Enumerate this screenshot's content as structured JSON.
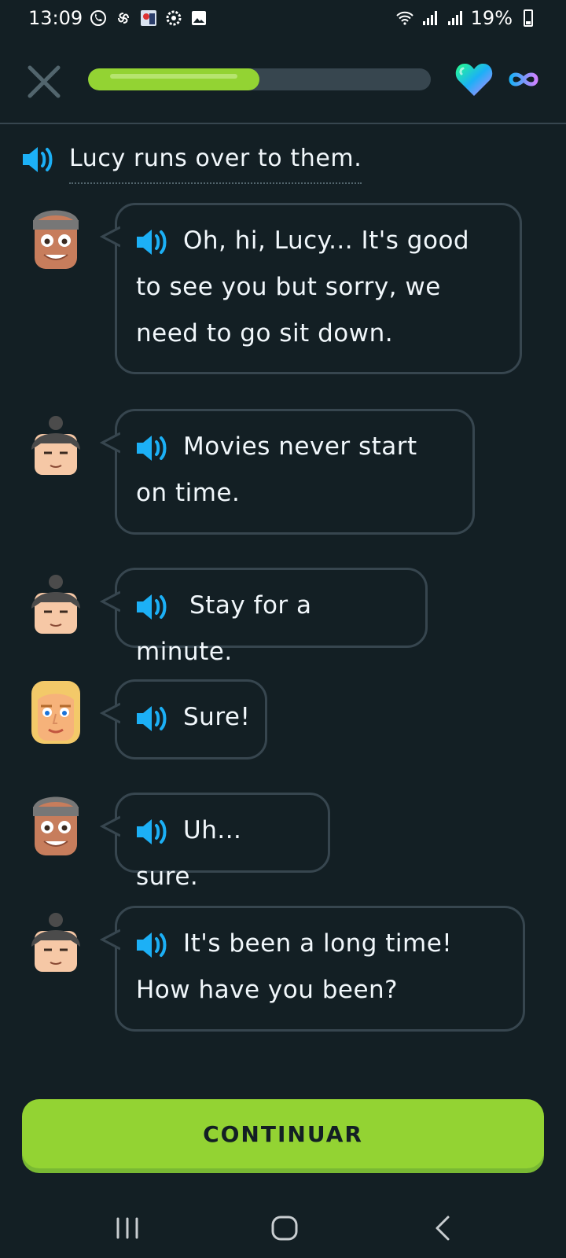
{
  "status_bar": {
    "time": "13:09",
    "battery": "19%"
  },
  "header": {
    "progress_fraction": 0.5,
    "hearts": "infinity"
  },
  "narration": {
    "text": "Lucy runs over to them."
  },
  "dialogue": [
    {
      "speaker": "man-gray-hair",
      "text": "Oh, hi, Lucy... It's good to see you but sorry, we need to go sit down."
    },
    {
      "speaker": "woman-bun",
      "text": "Movies never start on time."
    },
    {
      "speaker": "woman-bun",
      "text": "Stay for a minute."
    },
    {
      "speaker": "lucy-blonde",
      "text": "Sure!"
    },
    {
      "speaker": "man-gray-hair",
      "text": "Uh... sure."
    },
    {
      "speaker": "woman-bun",
      "text": "It's been a long time! How have you been?"
    }
  ],
  "continue_button": {
    "label": "CONTINUAR"
  },
  "colors": {
    "background": "#131f24",
    "accent_green": "#93d333",
    "speaker_blue": "#1cb0f6",
    "border": "#37464f"
  }
}
